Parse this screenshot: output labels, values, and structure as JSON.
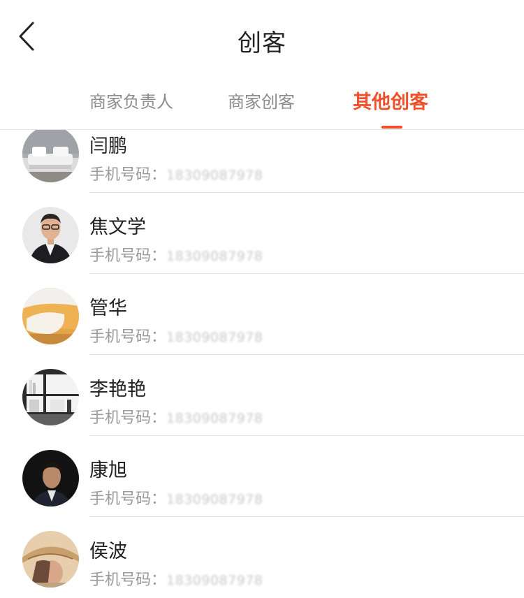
{
  "header": {
    "title": "创客"
  },
  "tabs": [
    {
      "label": "商家负责人",
      "active": false
    },
    {
      "label": "商家创客",
      "active": false
    },
    {
      "label": "其他创客",
      "active": true
    }
  ],
  "accent_color": "#f0502a",
  "phone_prefix": "手机号码：",
  "members": [
    {
      "name": "闫鹏",
      "phone": "18309087978"
    },
    {
      "name": "焦文学",
      "phone": "18309087978"
    },
    {
      "name": "管华",
      "phone": "18309087978"
    },
    {
      "name": "李艳艳",
      "phone": "18309087978"
    },
    {
      "name": "康旭",
      "phone": "18309087978"
    },
    {
      "name": "侯波",
      "phone": "18309087978"
    }
  ]
}
